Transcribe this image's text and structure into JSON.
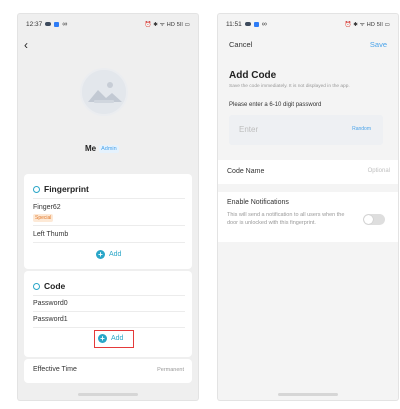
{
  "left_screen": {
    "status": {
      "time": "12:37",
      "right": "⏰ ✱ ᯤ HD 5ll ▭"
    },
    "user": {
      "name": "Me",
      "role_badge": "Admin"
    },
    "fingerprint": {
      "title": "Fingerprint",
      "items": [
        {
          "label": "Finger62",
          "tag": "Special"
        },
        {
          "label": "Left Thumb"
        }
      ],
      "add_label": "Add"
    },
    "code": {
      "title": "Code",
      "items": [
        {
          "label": "Password0"
        },
        {
          "label": "Password1"
        }
      ],
      "add_label": "Add"
    },
    "effective_time": {
      "label": "Effective Time",
      "value": "Permanent"
    }
  },
  "right_screen": {
    "status": {
      "time": "11:51",
      "right": "⏰ ✱ ᯤ HD 5ll ▭"
    },
    "cancel_label": "Cancel",
    "save_label": "Save",
    "title": "Add Code",
    "subtitle": "Save the code immediately. It is not displayed in the app.",
    "password_label": "Please enter a 6-10 digit password",
    "password_placeholder": "Enter",
    "random_label": "Random",
    "code_name_label": "Code Name",
    "code_name_optional": "Optional",
    "notifications_label": "Enable Notifications",
    "notifications_desc": "This will send a notification to all users when the door is unlocked with this fingerprint.",
    "notifications_enabled": false
  },
  "colors": {
    "accent": "#2aa6c8",
    "link": "#4aa3ea",
    "highlight": "#e43a3a",
    "special": "#e0782a"
  },
  "icons": [
    "back-arrow-icon",
    "fingerprint-icon",
    "code-icon",
    "plus-icon",
    "wifi-icon",
    "battery-icon"
  ]
}
